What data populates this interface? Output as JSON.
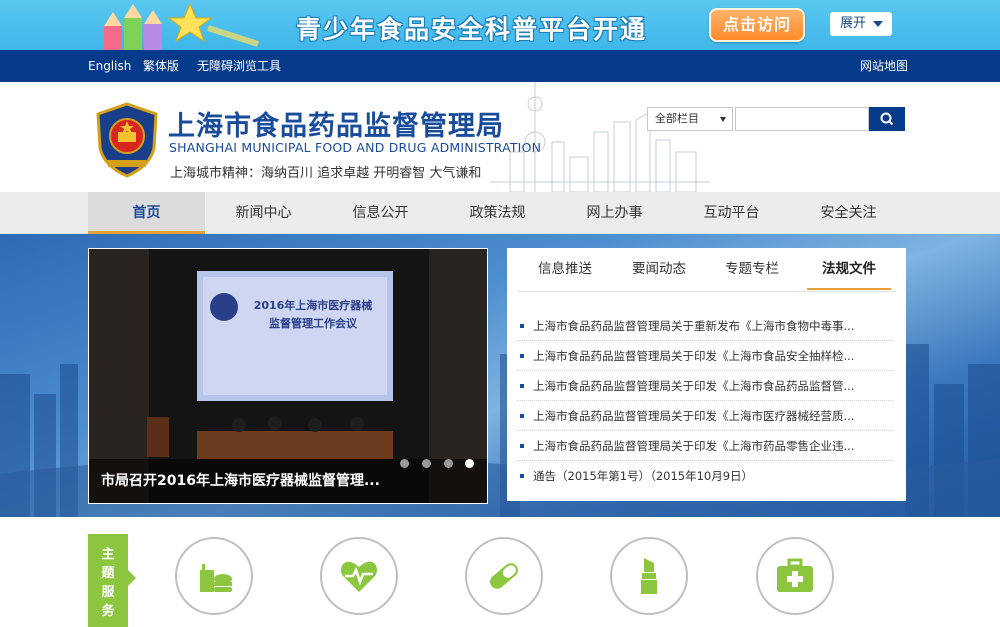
{
  "banner": {
    "title": "青少年食品安全科普平台开通",
    "visit_label": "点击访问",
    "expand_label": "展开"
  },
  "util_bar": {
    "english": "English",
    "traditional": "繁体版",
    "accessibility": "无障碍浏览工具",
    "sitemap": "网站地图"
  },
  "header": {
    "title": "上海市食品药品监督管理局",
    "subtitle": "SHANGHAI MUNICIPAL FOOD AND DRUG ADMINISTRATION",
    "motto": "上海城市精神：海纳百川  追求卓越  开明睿智  大气谦和"
  },
  "search": {
    "scope": "全部栏目",
    "placeholder": ""
  },
  "nav": {
    "items": [
      {
        "label": "首页"
      },
      {
        "label": "新闻中心"
      },
      {
        "label": "信息公开"
      },
      {
        "label": "政策法规"
      },
      {
        "label": "网上办事"
      },
      {
        "label": "互动平台"
      },
      {
        "label": "安全关注"
      }
    ]
  },
  "slider": {
    "caption": "市局召开2016年上海市医疗器械监督管理...",
    "screen_title_line1": "2016年上海市医疗器械",
    "screen_title_line2": "监督管理工作会议",
    "active_index": 3
  },
  "news": {
    "tabs": [
      {
        "label": "信息推送"
      },
      {
        "label": "要闻动态"
      },
      {
        "label": "专题专栏"
      },
      {
        "label": "法规文件"
      }
    ],
    "items": [
      {
        "text": "上海市食品药品监督管理局关于重新发布《上海市食物中毒事..."
      },
      {
        "text": "上海市食品药品监督管理局关于印发《上海市食品安全抽样检..."
      },
      {
        "text": "上海市食品药品监督管理局关于印发《上海市食品药品监督管..."
      },
      {
        "text": "上海市食品药品监督管理局关于印发《上海市医疗器械经营质..."
      },
      {
        "text": "上海市食品药品监督管理局关于印发《上海市药品零售企业违..."
      },
      {
        "text": "通告（2015年第1号）（2015年10月9日）"
      }
    ]
  },
  "services": {
    "tag": "主题服务",
    "accent_color": "#8cc63f",
    "items": [
      {
        "icon": "food-icon"
      },
      {
        "icon": "health-heart-icon"
      },
      {
        "icon": "pill-icon"
      },
      {
        "icon": "lipstick-icon"
      },
      {
        "icon": "medical-kit-icon"
      }
    ]
  },
  "colors": {
    "brand_blue": "#063b8c",
    "title_blue": "#1a4c9c",
    "active_underline": "#e8a13a"
  }
}
